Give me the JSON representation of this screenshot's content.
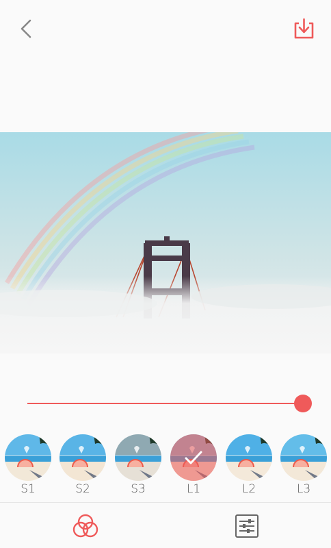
{
  "topbar": {
    "back_icon": "chevron-left-icon",
    "download_icon": "download-tray-icon",
    "accent": "#ef5a5a"
  },
  "editor": {
    "intensity": 1.0
  },
  "filters": [
    {
      "label": "S1",
      "selected": false
    },
    {
      "label": "S2",
      "selected": false
    },
    {
      "label": "S3",
      "selected": false
    },
    {
      "label": "L1",
      "selected": true
    },
    {
      "label": "L2",
      "selected": false
    },
    {
      "label": "L3",
      "selected": false
    }
  ],
  "bottombar": {
    "filters_tab_icon": "overlapping-circles-icon",
    "adjust_tab_icon": "sliders-icon",
    "active_tab": "filters"
  }
}
